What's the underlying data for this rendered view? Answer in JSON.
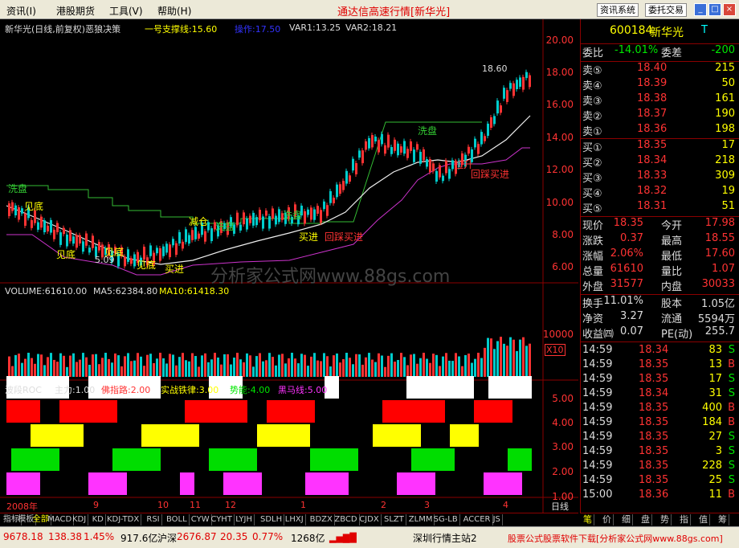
{
  "menu": [
    "资讯(I)",
    "港股期货",
    "工具(V)",
    "帮助(H)"
  ],
  "app_title": "通达信高速行情[新华光]",
  "toolbar_btns": [
    "资讯系统",
    "委托交易"
  ],
  "main": {
    "header": [
      "新华光(日线,前复权)恶狼决策",
      "一号支撑线:15.60",
      "操作:17.50",
      "VAR1:13.25",
      "VAR2:18.21"
    ],
    "y_labels": [
      "20.00",
      "18.00",
      "16.00",
      "14.00",
      "12.00",
      "10.00",
      "8.00",
      "6.00"
    ],
    "annotations": {
      "high": "18.60",
      "low": "5.09",
      "wash1": "洗盘",
      "wash2": "洗盘",
      "wash3": "洗盘",
      "wash4": "洗盘",
      "bottom1": "见底",
      "bottom2": "见底",
      "bottom3": "见底",
      "bottom4": "见底",
      "buy1": "买进",
      "buy2": "买进",
      "buy3": "回踩买进",
      "buy4": "回踩买进",
      "rise": "拉升",
      "cut": "减仓",
      "watermark": "分析家公式网www.88gs.com"
    }
  },
  "volume": {
    "header": [
      "VOLUME:61610.00",
      "MA5:62384.80",
      "MA10:61418.30"
    ],
    "y_label": "10000",
    "unit": "X10"
  },
  "roc": {
    "header": [
      "波段ROC",
      "主力:1.00",
      "佛指路:2.00",
      "实战铁律:3.00",
      "势能:4.00",
      "黑马线:5.00"
    ],
    "y_labels": [
      "5.00",
      "4.00",
      "3.00",
      "2.00",
      "1.00"
    ]
  },
  "xaxis": {
    "labels": [
      "2008年",
      "9",
      "10",
      "11",
      "12",
      "1",
      "2",
      "3",
      "4"
    ],
    "period": "日线"
  },
  "tabs": [
    "指标",
    "模板",
    "全部",
    "MACD",
    "KDJ",
    "KD",
    "KDJ-TDX",
    "RSI",
    "BOLL",
    "CYW",
    "CYHT",
    "LYJH",
    "SDLH",
    "LHXJ",
    "BDZX",
    "ZBCD",
    "CJDX",
    "SLZT",
    "ZLMM",
    "SG-LB",
    "ACCER",
    "JS"
  ],
  "rtabs": [
    "笔",
    "价",
    "细",
    "盘",
    "势",
    "指",
    "值",
    "筹"
  ],
  "quote": {
    "code": "600184",
    "name": "新华光",
    "flag": "T",
    "weibi_label": "委比",
    "weibi": "-14.01%",
    "weicha_label": "委差",
    "weicha": "-200",
    "asks": [
      {
        "l": "卖⑤",
        "p": "18.40",
        "v": "215"
      },
      {
        "l": "卖④",
        "p": "18.39",
        "v": "50"
      },
      {
        "l": "卖③",
        "p": "18.38",
        "v": "161"
      },
      {
        "l": "卖②",
        "p": "18.37",
        "v": "190"
      },
      {
        "l": "卖①",
        "p": "18.36",
        "v": "198"
      }
    ],
    "bids": [
      {
        "l": "买①",
        "p": "18.35",
        "v": "17"
      },
      {
        "l": "买②",
        "p": "18.34",
        "v": "218"
      },
      {
        "l": "买③",
        "p": "18.33",
        "v": "309"
      },
      {
        "l": "买④",
        "p": "18.32",
        "v": "19"
      },
      {
        "l": "买⑤",
        "p": "18.31",
        "v": "51"
      }
    ],
    "stats": [
      {
        "a": "现价",
        "av": "18.35",
        "b": "今开",
        "bv": "17.98"
      },
      {
        "a": "涨跌",
        "av": "0.37",
        "b": "最高",
        "bv": "18.55"
      },
      {
        "a": "涨幅",
        "av": "2.06%",
        "b": "最低",
        "bv": "17.60"
      },
      {
        "a": "总量",
        "av": "61610",
        "b": "量比",
        "bv": "1.07"
      },
      {
        "a": "外盘",
        "av": "31577",
        "b": "内盘",
        "bv": "30033"
      }
    ],
    "stats2": [
      {
        "a": "换手",
        "av": "11.01%",
        "b": "股本",
        "bv": "1.05亿"
      },
      {
        "a": "净资",
        "av": "3.27",
        "b": "流通",
        "bv": "5594万"
      },
      {
        "a": "收益㈣",
        "av": "0.07",
        "b": "PE(动)",
        "bv": "255.7"
      }
    ],
    "ticks": [
      {
        "t": "14:59",
        "p": "18.34",
        "v": "83",
        "d": "S"
      },
      {
        "t": "14:59",
        "p": "18.35",
        "v": "13",
        "d": "B"
      },
      {
        "t": "14:59",
        "p": "18.35",
        "v": "17",
        "d": "S"
      },
      {
        "t": "14:59",
        "p": "18.34",
        "v": "31",
        "d": "S"
      },
      {
        "t": "14:59",
        "p": "18.35",
        "v": "400",
        "d": "B"
      },
      {
        "t": "14:59",
        "p": "18.35",
        "v": "184",
        "d": "B"
      },
      {
        "t": "14:59",
        "p": "18.35",
        "v": "27",
        "d": "S"
      },
      {
        "t": "14:59",
        "p": "18.35",
        "v": "3",
        "d": "S"
      },
      {
        "t": "14:59",
        "p": "18.35",
        "v": "228",
        "d": "S"
      },
      {
        "t": "14:59",
        "p": "18.35",
        "v": "25",
        "d": "S"
      },
      {
        "t": "15:00",
        "p": "18.36",
        "v": "11",
        "d": "B"
      }
    ]
  },
  "status": {
    "sh_idx": "9678.18",
    "sh_chg": "138.38",
    "sh_pct": "1.45%",
    "sh_amt": "917.6亿",
    "sz_label": "沪深",
    "sz_idx": "2676.87",
    "sz_chg": "20.35",
    "sz_pct": "0.77%",
    "sz_amt": "1268亿",
    "server": "深圳行情主站2",
    "ad": "股票公式股票软件下载[分析家公式网www.88gs.com]"
  },
  "colors": {
    "up": "#ff3333",
    "down": "#00e600",
    "ma": "#ffffff",
    "support": "#cc33cc",
    "pressure": "#33cc33"
  }
}
